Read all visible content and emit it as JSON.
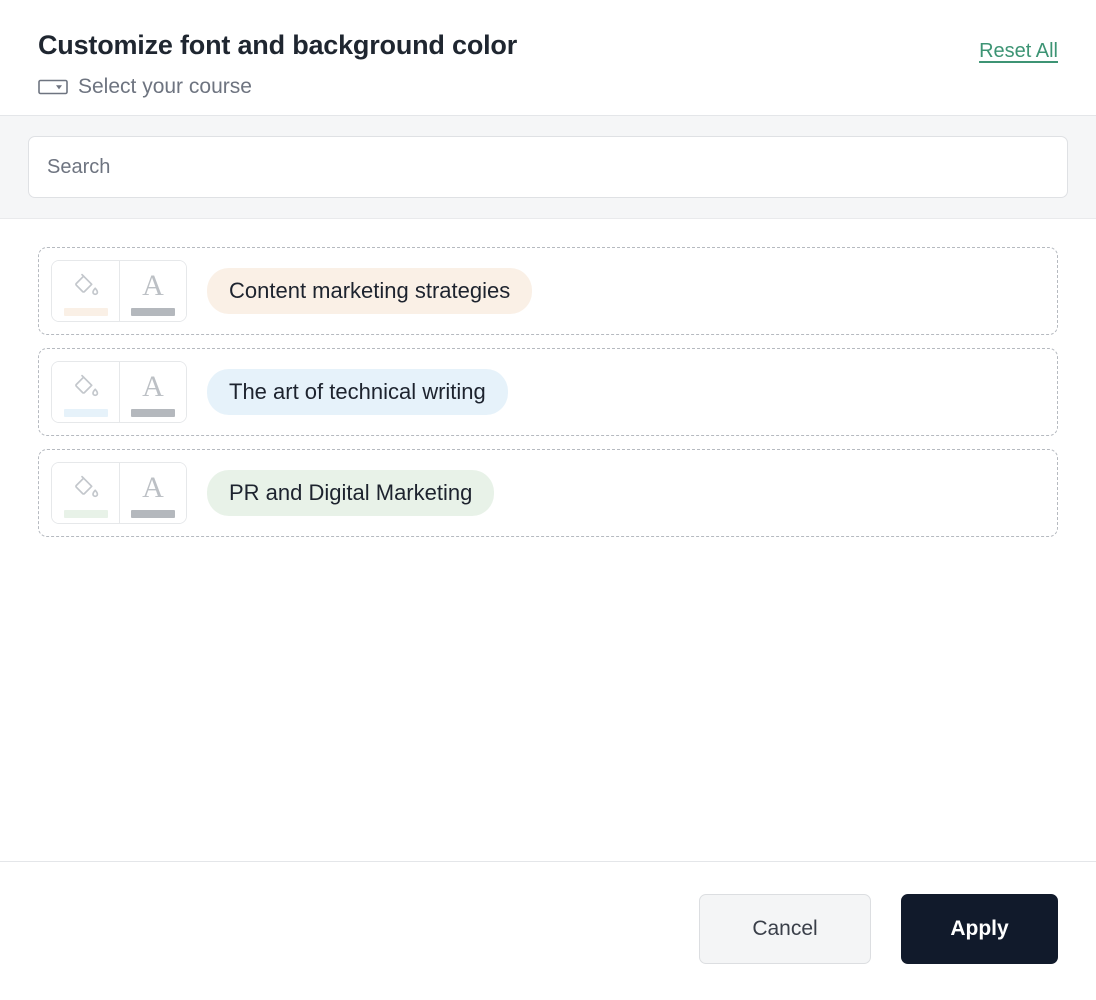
{
  "header": {
    "title": "Customize font and background color",
    "reset_label": "Reset All",
    "subtitle": "Select your course",
    "subtitle_icon": "dropdown-select-icon",
    "reset_color": "#3d9474"
  },
  "search": {
    "placeholder": "Search",
    "value": ""
  },
  "courses": [
    {
      "name": "Content marketing strategies",
      "pill_background": "#faf0e6",
      "background_swatch": "#faf0e6",
      "font_swatch": "#b4b8bd",
      "fill_icon": "paint-bucket-icon",
      "font_icon": "font-color-icon"
    },
    {
      "name": "The art of technical writing",
      "pill_background": "#e6f2fa",
      "background_swatch": "#e6f2fa",
      "font_swatch": "#b4b8bd",
      "fill_icon": "paint-bucket-icon",
      "font_icon": "font-color-icon"
    },
    {
      "name": "PR and Digital Marketing",
      "pill_background": "#e8f2e8",
      "background_swatch": "#e8f2e8",
      "font_swatch": "#b4b8bd",
      "fill_icon": "paint-bucket-icon",
      "font_icon": "font-color-icon"
    }
  ],
  "footer": {
    "cancel_label": "Cancel",
    "apply_label": "Apply",
    "apply_background": "#111a2b"
  }
}
